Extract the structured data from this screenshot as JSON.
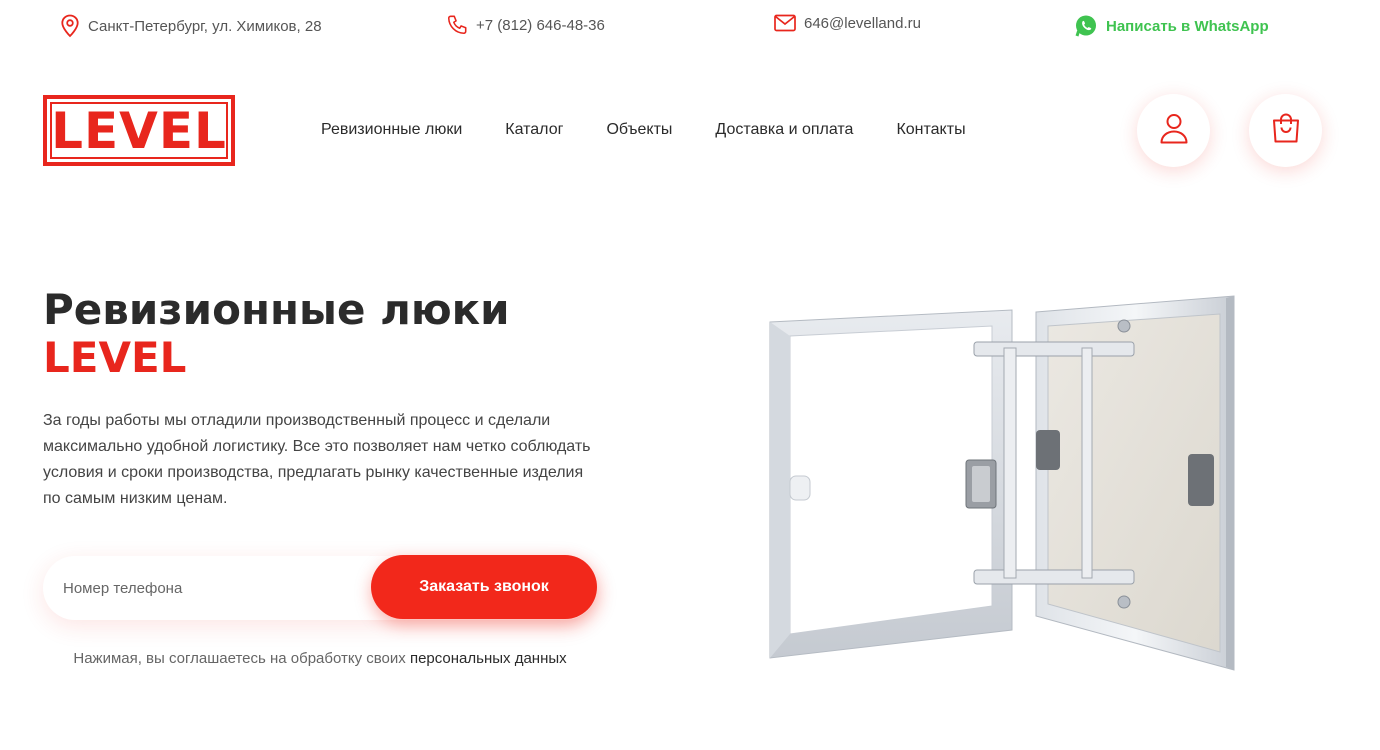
{
  "topbar": {
    "address": "Санкт-Петербург, ул. Химиков, 28",
    "phone": "+7 (812) 646-48-36",
    "email": "646@levelland.ru",
    "whatsapp": "Написать в WhatsApp"
  },
  "logo": {
    "text": "LEVEL"
  },
  "nav": [
    {
      "label": "Ревизионные люки"
    },
    {
      "label": "Каталог"
    },
    {
      "label": "Объекты"
    },
    {
      "label": "Доставка и оплата"
    },
    {
      "label": "Контакты"
    }
  ],
  "hero": {
    "title_line1": "Ревизионные люки",
    "title_line2": "LEVEL",
    "description": "За годы работы мы отладили производственный процесс и сделали максимально удобной логистику. Все это позволяет нам четко соблюдать условия и сроки производства, предлагать рынку качественные изделия по самым низким ценам."
  },
  "form": {
    "phone_placeholder": "Номер телефона",
    "submit_label": "Заказать звонок",
    "consent_text": "Нажимая, вы соглашаетесь на обработку своих ",
    "consent_link": "персональных данных"
  },
  "colors": {
    "accent": "#e8261d",
    "whatsapp": "#3fc350"
  }
}
